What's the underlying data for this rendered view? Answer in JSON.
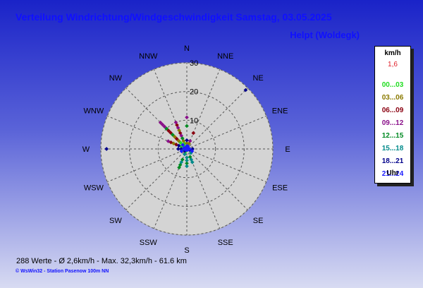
{
  "title": "Verteilung Windrichtung/Windgeschwindigkeit  Samstag, 03.05.2025",
  "station": "Helpt (Woldegk)",
  "stats": "288 Werte   -   Ø 2,6km/h  -  Max. 32,3km/h   -   61.6 km",
  "footer": "© WsWin32  -  Station Pasenow 100m NN",
  "legend": {
    "unit": "km/h",
    "avg": "1,6",
    "slots": [
      {
        "label": "00...03",
        "color": "#22dd22"
      },
      {
        "label": "03...06",
        "color": "#8a7a00"
      },
      {
        "label": "06...09",
        "color": "#8a0010"
      },
      {
        "label": "09...12",
        "color": "#8a108a"
      },
      {
        "label": "12...15",
        "color": "#008a22"
      },
      {
        "label": "15...18",
        "color": "#008a8a"
      },
      {
        "label": "18...21",
        "color": "#00008a"
      },
      {
        "label": "21...24",
        "color": "#1a1aff"
      }
    ],
    "hour_label": "Uhr"
  },
  "chart_data": {
    "type": "scatter",
    "polar": true,
    "directions": [
      "N",
      "NNE",
      "NE",
      "ENE",
      "E",
      "ESE",
      "SE",
      "SSE",
      "S",
      "SSW",
      "SW",
      "WSW",
      "W",
      "WNW",
      "NW",
      "NNW"
    ],
    "rlim": [
      0,
      30
    ],
    "rticks": [
      10,
      20,
      30
    ],
    "grid": true,
    "legend_position": "right",
    "series": [
      {
        "name": "00...03",
        "points": [
          [
            292.5,
            1
          ],
          [
            270,
            1
          ],
          [
            315,
            1
          ],
          [
            90,
            1
          ],
          [
            202.5,
            1
          ],
          [
            337.5,
            2
          ],
          [
            0,
            1
          ],
          [
            247.5,
            1
          ],
          [
            315,
            3
          ],
          [
            292.5,
            2
          ],
          [
            292.5,
            4
          ]
        ]
      },
      {
        "name": "03...06",
        "points": [
          [
            337.5,
            3
          ],
          [
            315,
            4
          ],
          [
            337.5,
            7
          ],
          [
            315,
            6
          ],
          [
            0,
            2
          ],
          [
            292.5,
            5
          ],
          [
            22.5,
            2
          ]
        ]
      },
      {
        "name": "06...09",
        "points": [
          [
            337.5,
            6
          ],
          [
            315,
            8
          ],
          [
            22.5,
            6
          ],
          [
            337.5,
            9
          ],
          [
            292.5,
            6
          ],
          [
            315,
            5
          ],
          [
            315,
            9
          ],
          [
            292.5,
            4
          ]
        ]
      },
      {
        "name": "09...12",
        "points": [
          [
            337.5,
            10
          ],
          [
            315,
            13
          ],
          [
            0,
            11
          ],
          [
            315,
            11
          ],
          [
            292.5,
            7
          ],
          [
            337.5,
            5
          ],
          [
            337.5,
            8
          ],
          [
            22.5,
            3
          ],
          [
            315,
            12
          ]
        ]
      },
      {
        "name": "12...15",
        "points": [
          [
            202.5,
            7
          ],
          [
            180,
            5
          ],
          [
            315,
            10
          ],
          [
            337.5,
            4
          ],
          [
            157.5,
            3
          ],
          [
            202.5,
            4
          ],
          [
            315,
            7
          ],
          [
            0,
            8
          ],
          [
            202.5,
            6
          ]
        ]
      },
      {
        "name": "15...18",
        "points": [
          [
            180,
            6
          ],
          [
            202.5,
            5
          ],
          [
            180,
            4
          ],
          [
            157.5,
            5
          ],
          [
            135,
            2
          ],
          [
            202.5,
            2
          ],
          [
            180,
            3
          ],
          [
            157.5,
            4
          ]
        ]
      },
      {
        "name": "18...21",
        "points": [
          [
            270,
            2
          ],
          [
            247.5,
            2
          ],
          [
            292.5,
            3
          ],
          [
            270,
            3
          ],
          [
            112.5,
            1
          ],
          [
            90,
            2
          ],
          [
            0,
            3
          ],
          [
            225,
            1
          ],
          [
            45,
            29
          ],
          [
            270,
            28
          ]
        ]
      },
      {
        "name": "21...24",
        "points": [
          [
            270,
            1
          ],
          [
            0,
            1
          ],
          [
            90,
            1
          ],
          [
            315,
            2
          ],
          [
            247.5,
            2
          ],
          [
            22.5,
            1
          ],
          [
            292.5,
            1
          ],
          [
            112.5,
            2
          ]
        ]
      }
    ]
  }
}
